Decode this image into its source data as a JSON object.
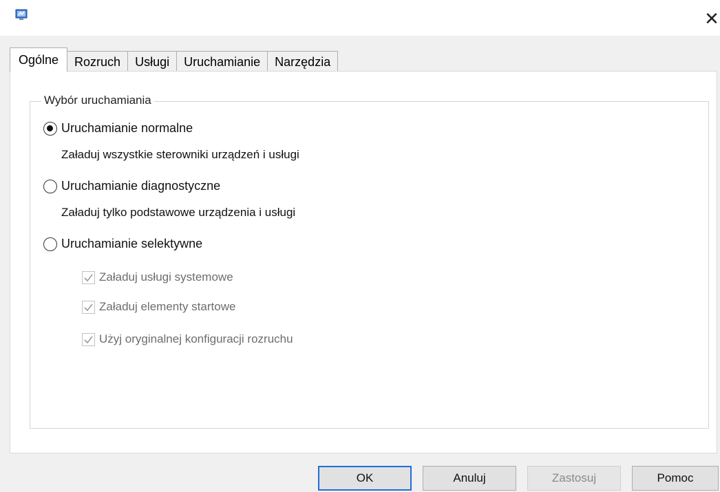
{
  "window": {
    "app_icon": "msconfig-icon",
    "close_symbol": "✕"
  },
  "tabs": [
    {
      "label": "Ogólne",
      "active": true
    },
    {
      "label": "Rozruch",
      "active": false
    },
    {
      "label": "Usługi",
      "active": false
    },
    {
      "label": "Uruchamianie",
      "active": false
    },
    {
      "label": "Narzędzia",
      "active": false
    }
  ],
  "startup_selection": {
    "group_label": "Wybór uruchamiania",
    "options": [
      {
        "label": "Uruchamianie normalne",
        "description": "Załaduj wszystkie sterowniki urządzeń i usługi",
        "selected": true
      },
      {
        "label": "Uruchamianie diagnostyczne",
        "description": "Załaduj tylko podstawowe urządzenia i usługi",
        "selected": false
      },
      {
        "label": "Uruchamianie selektywne",
        "selected": false
      }
    ],
    "selective_checkboxes": [
      {
        "label": "Załaduj usługi systemowe",
        "checked": true,
        "enabled": false
      },
      {
        "label": "Załaduj elementy startowe",
        "checked": true,
        "enabled": false
      },
      {
        "label": "Użyj oryginalnej konfiguracji rozruchu",
        "checked": true,
        "enabled": false
      }
    ]
  },
  "buttons": {
    "ok": "OK",
    "cancel": "Anuluj",
    "apply": "Zastosuj",
    "help": "Pomoc"
  },
  "colors": {
    "default_button_border": "#1f6fd6",
    "disabled_text": "#8a8a8a"
  }
}
